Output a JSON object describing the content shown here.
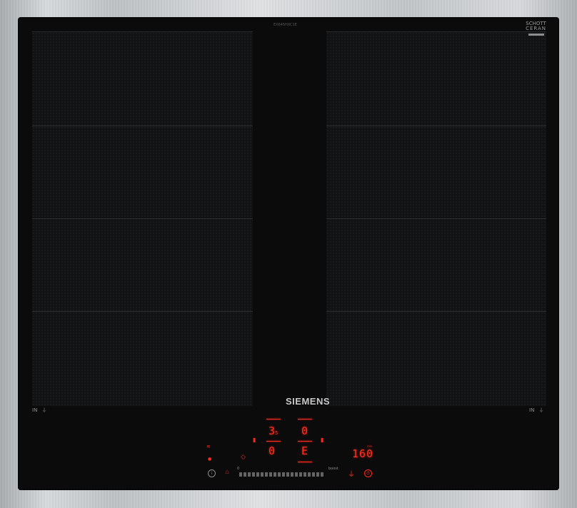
{
  "brand": {
    "name": "SIEMENS"
  },
  "glass_maker": {
    "line1": "SCHOTT",
    "line2": "CERAN"
  },
  "model_text": "EX645HXC1E",
  "zones": {
    "left_label": "IN",
    "right_label": "IN"
  },
  "display": {
    "zone_top_left_level": "3",
    "zone_top_left_sub": "5",
    "zone_top_right_level": "0",
    "zone_bottom_left_level": "0",
    "zone_bottom_right_level": "E",
    "timer_value": "160",
    "slider_min": "0",
    "slider_boost": "boost",
    "timer_unit": "min"
  },
  "colors": {
    "display": "#ff2a1a",
    "glass": "#0b0b0c"
  },
  "icons": [
    "info-icon",
    "lock-icon",
    "powermove-icon",
    "keep-warm-icon",
    "timer-icon",
    "power-icon"
  ]
}
